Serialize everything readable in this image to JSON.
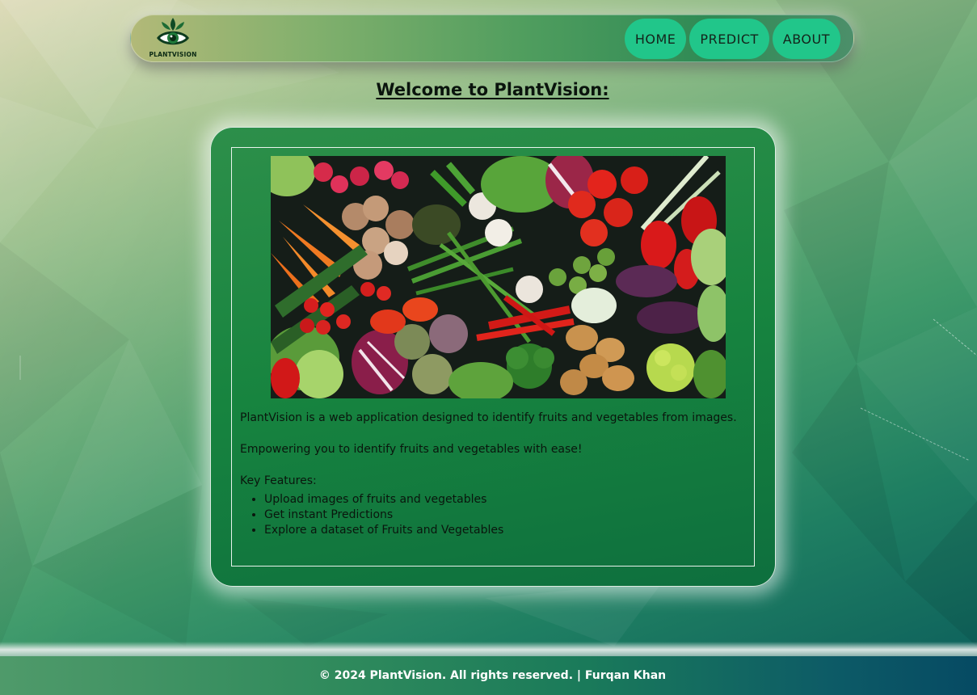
{
  "brand": {
    "logo_text": "PLANTVISION"
  },
  "nav": {
    "items": [
      {
        "label": "HOME"
      },
      {
        "label": "PREDICT"
      },
      {
        "label": "ABOUT"
      }
    ]
  },
  "main": {
    "title": "Welcome to PlantVision:",
    "description": "PlantVision is a web application designed to identify fruits and vegetables from images.",
    "tagline": "Empowering you to identify fruits and vegetables with ease!",
    "features_label": "Key Features:",
    "features": [
      "Upload images of fruits and vegetables",
      "Get instant Predictions",
      "Explore a dataset of Fruits and Vegetables"
    ]
  },
  "footer": {
    "text": "© 2024 PlantVision. All rights reserved. | Furqan Khan"
  },
  "colors": {
    "nav_button": "#21c68a",
    "card": "#17843f",
    "footer_end": "#064a63"
  }
}
